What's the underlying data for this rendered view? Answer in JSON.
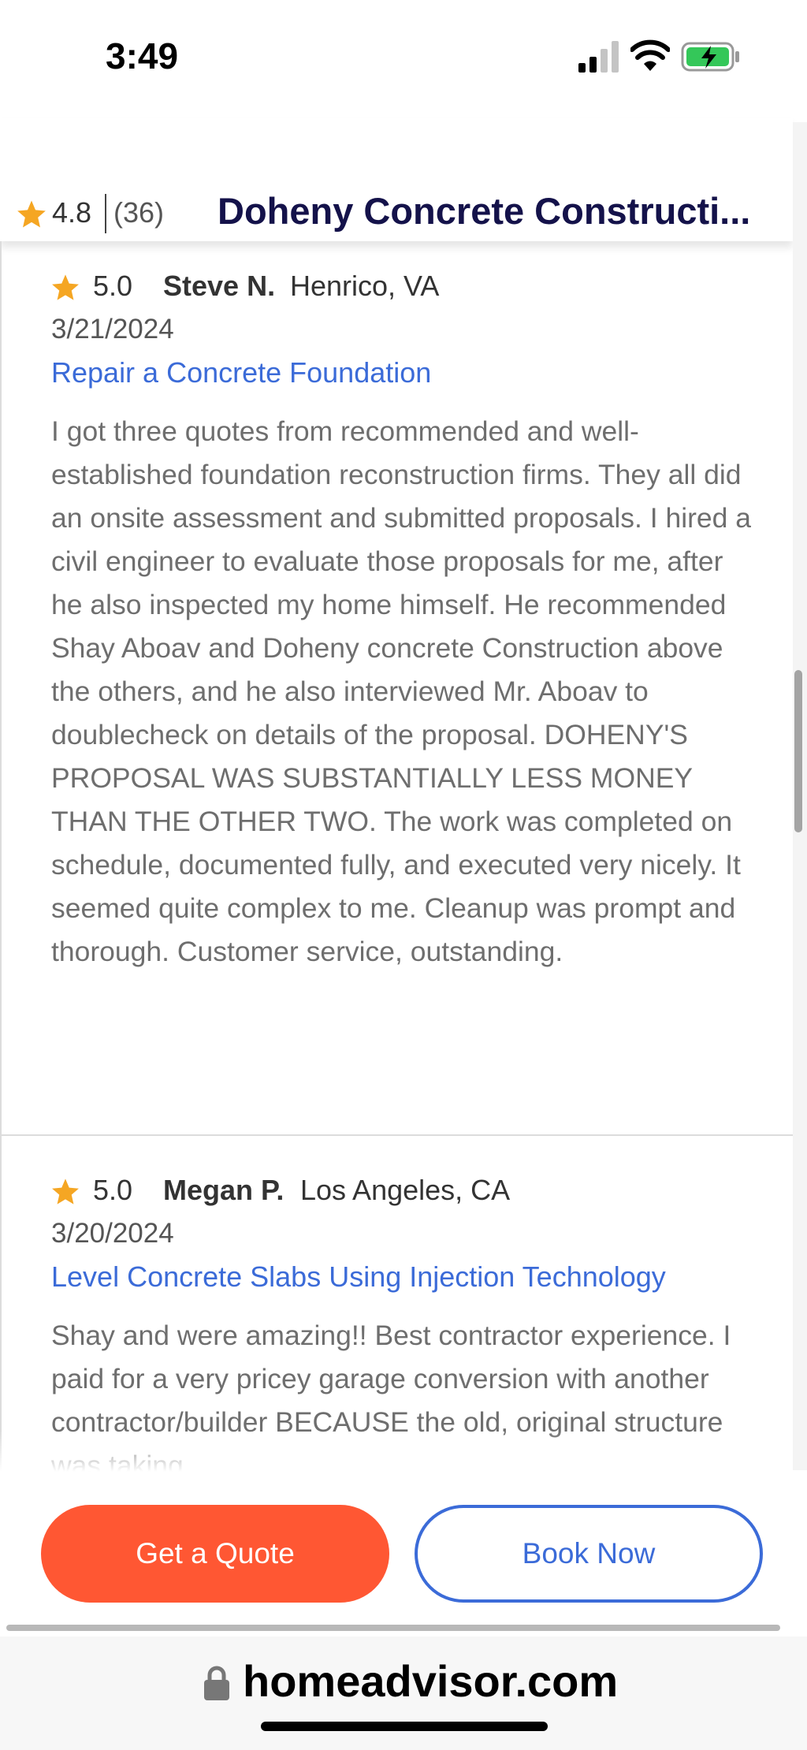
{
  "status_bar": {
    "time": "3:49"
  },
  "header": {
    "rating": "4.8",
    "review_count": "(36)",
    "business_name": "Doheny Concrete Constructi..."
  },
  "reviews": [
    {
      "rating": "5.0",
      "name": "Steve N.",
      "location": "Henrico, VA",
      "date": "3/21/2024",
      "service": "Repair a Concrete Foundation",
      "body": "I got three quotes from recommended and well-established foundation reconstruction firms. They all did an onsite assessment and submitted proposals. I hired a civil engineer to evaluate those proposals for me, after he also inspected my home himself. He recommended Shay Aboav and Doheny concrete Construction above the others, and he also interviewed Mr. Aboav to doublecheck on details of the proposal. DOHENY'S PROPOSAL WAS SUBSTANTIALLY LESS MONEY THAN THE OTHER TWO. The work was completed on schedule, documented fully, and executed very nicely. It seemed quite complex to me. Cleanup was prompt and thorough. Customer service, outstanding."
    },
    {
      "rating": "5.0",
      "name": "Megan P.",
      "location": "Los Angeles, CA",
      "date": "3/20/2024",
      "service": "Level Concrete Slabs Using Injection Technology",
      "body": "Shay and were amazing!! Best contractor experience. I paid for a very pricey garage conversion with another contractor/builder BECAUSE the old, original structure was taking"
    }
  ],
  "actions": {
    "quote_label": "Get a Quote",
    "book_label": "Book Now"
  },
  "browser": {
    "url": "homeadvisor.com"
  },
  "colors": {
    "accent_orange": "#ff5733",
    "link_blue": "#3b6bd8",
    "star": "#f5a623",
    "title_navy": "#14124a"
  }
}
